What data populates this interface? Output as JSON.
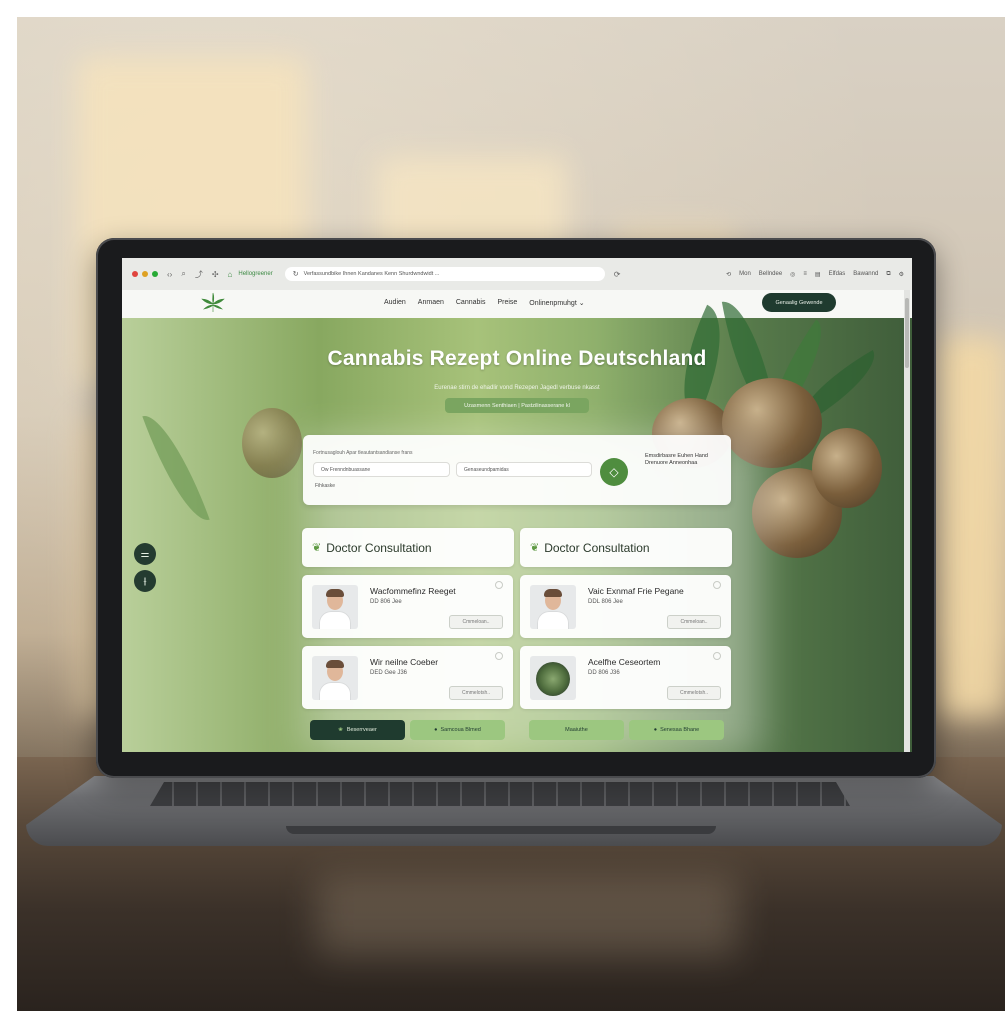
{
  "browser": {
    "tab_title": "Hellogreener",
    "url": "Verfassundbike  Ihnen  Kandanes Kenn Shurdwndwidt ...",
    "toolbar_right": [
      "Mon",
      "Bellndee",
      "Elfdas",
      "Bawannd"
    ]
  },
  "site": {
    "nav_links": [
      "Audien",
      "Anmaen",
      "Cannabis",
      "Preise",
      "Onlinenpmuhgt"
    ],
    "nav_dropdown_icon": "chevron-down-icon",
    "nav_cta": "Genaalig Gewende",
    "logo_icon": "cannabis-leaf-icon"
  },
  "hero": {
    "title": "Cannabis Rezept Online Deutschland",
    "subtitle": "Eurenae stirn de ehadlir vond Rezepen Jagedl verbuse nkasst",
    "pill": "Uzasmenn Senthiaen  |  Pastzilinasserane kl"
  },
  "search": {
    "label": "Fortnusaglouh Apar tleautantsandianse frans",
    "field1_placeholder": "Ow Frenndnbuassane",
    "field2_placeholder": "Genaseundpamidas",
    "small_label": "Fihkaske",
    "go_icon": "diamond-arrow-icon",
    "note": "Emsdirbasre Euhen Hand Drenuore Anneonhaa"
  },
  "sections": {
    "left_title": "Doctor Consultation",
    "right_title": "Doctor Consultation",
    "icon": "sprout-icon"
  },
  "doctors": [
    {
      "name": "Wacfommefinz Reeget",
      "meta": "DD  806  Jee",
      "button": "Cmmeloan.."
    },
    {
      "name": "Vaic Exnmaf Frie Pegane",
      "meta": "DDL  806  Jee",
      "button": "Cmmeloan.."
    },
    {
      "name": "Wir neilne Coeber",
      "meta": "DED  Gee  J36",
      "button": "Cmmelotsh.."
    },
    {
      "name": "Acelfhe Ceseortem",
      "meta": "DD  806  J36",
      "button": "Cmmelotsh.."
    }
  ],
  "bottom_buttons": [
    "Beserrveaer",
    "Samcoua Blmed",
    "Maaiuthe",
    "Senesaa Bhane"
  ],
  "left_floating": [
    "sliders-icon",
    "tune-icon"
  ],
  "colors": {
    "brand_dark": "#1f3b2f",
    "brand_green": "#4f8d3f",
    "light_green": "#9cc780"
  }
}
